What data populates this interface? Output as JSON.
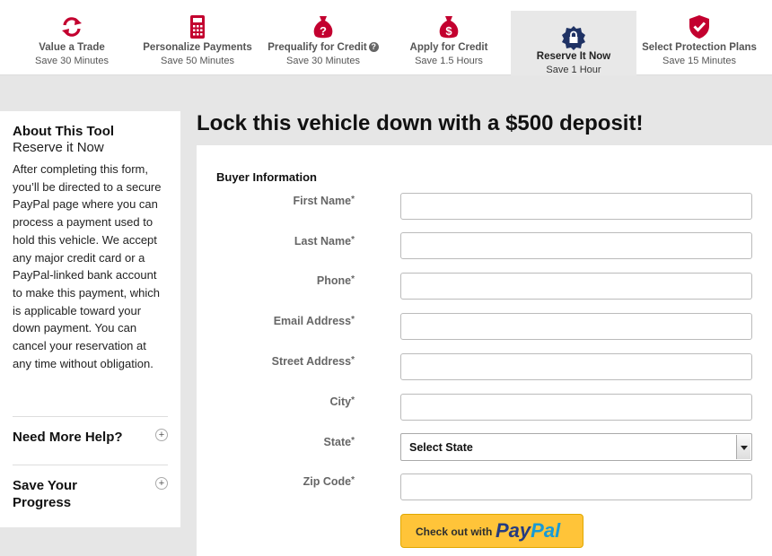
{
  "steps": [
    {
      "label": "Value a Trade",
      "sub": "Save 30 Minutes",
      "icon": "refresh-icon"
    },
    {
      "label": "Personalize Payments",
      "sub": "Save 50 Minutes",
      "icon": "calculator-icon"
    },
    {
      "label": "Prequalify for Credit",
      "sub": "Save 30 Minutes",
      "icon": "money-bag-question-icon"
    },
    {
      "label": "Apply for Credit",
      "sub": "Save 1.5 Hours",
      "icon": "money-bag-dollar-icon"
    },
    {
      "label": "Reserve It Now",
      "sub": "Save 1 Hour",
      "icon": "lock-badge-icon"
    },
    {
      "label": "Select Protection Plans",
      "sub": "Save 15 Minutes",
      "icon": "shield-check-icon"
    }
  ],
  "colors": {
    "accent": "#c3002f",
    "navy": "#1f3264",
    "paypal_yellow": "#ffc439"
  },
  "sidebar": {
    "title": "About This Tool",
    "subtitle": "Reserve it Now",
    "body": "After completing this form, you’ll be directed to a secure PayPal page where you can process a payment used to hold this vehicle. We accept any major credit card or a PayPal-linked bank account to make this payment, which is applicable toward your down payment. You can cancel your reservation at any time without obligation.",
    "help": "Need More Help?",
    "save": "Save Your Progress",
    "plus": "+"
  },
  "main": {
    "title": "Lock this vehicle down with a $500 deposit!",
    "section": "Buyer Information",
    "req": "*",
    "labels": {
      "first": "First Name",
      "last": "Last Name",
      "phone": "Phone",
      "email": "Email Address",
      "street": "Street Address",
      "city": "City",
      "state": "State",
      "zip": "Zip Code"
    },
    "state_value": "Select State",
    "paypal_prefix": "Check out with",
    "paypal_a": "Pay",
    "paypal_b": "Pal"
  }
}
